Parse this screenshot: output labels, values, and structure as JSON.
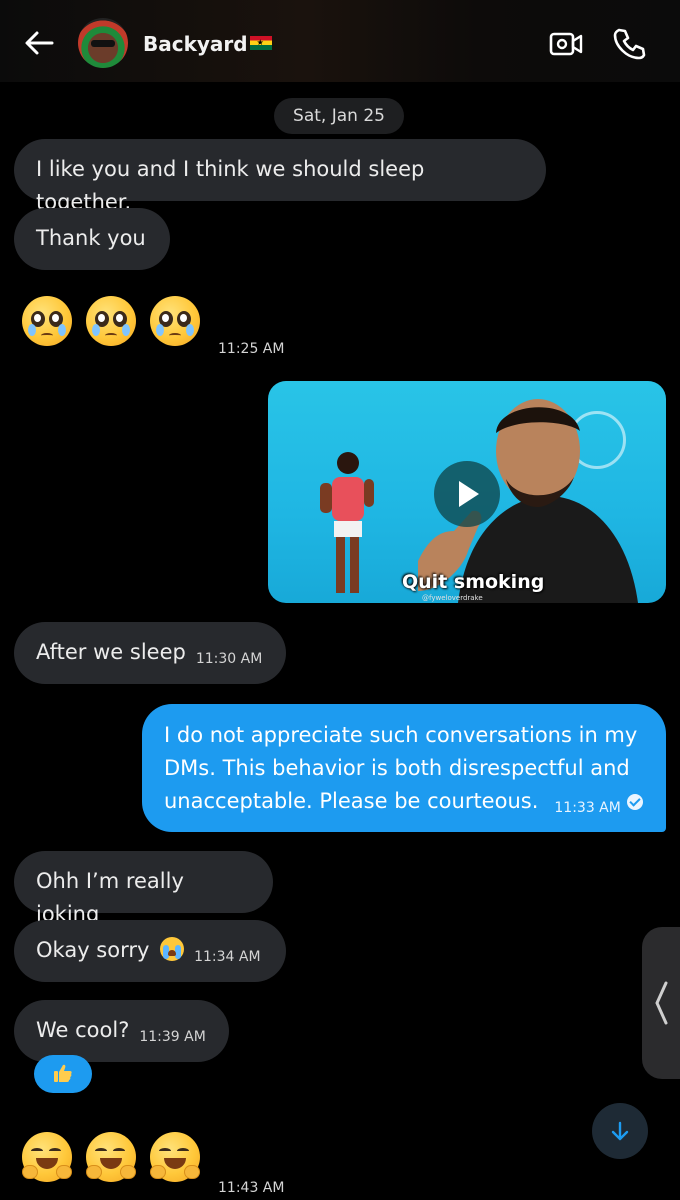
{
  "header": {
    "contact_name": "Backyard",
    "flag": "ghana-flag"
  },
  "conversation": {
    "date_label": "Sat, Jan 25",
    "messages": [
      {
        "from": "them",
        "text": "I like you and I think we should sleep together."
      },
      {
        "from": "them",
        "text": "Thank you"
      },
      {
        "from": "them",
        "emoji": "pleading-face x3",
        "time": "11:25 AM"
      },
      {
        "from": "me",
        "media": "video",
        "caption": "Quit smoking",
        "credit": "@fyweloverdrake"
      },
      {
        "from": "them",
        "text": "After we sleep",
        "time": "11:30 AM"
      },
      {
        "from": "me",
        "lines": [
          "I do not appreciate such conversations in my",
          "DMs. This behavior is both disrespectful and",
          "unacceptable. Please be courteous."
        ],
        "time": "11:33 AM",
        "status": "read"
      },
      {
        "from": "them",
        "text": "Ohh I’m really joking"
      },
      {
        "from": "them",
        "text": "Okay sorry",
        "emoji": "crying-face",
        "time": "11:34 AM"
      },
      {
        "from": "them",
        "text": "We cool?",
        "time": "11:39 AM",
        "reaction": "thumbs-up"
      },
      {
        "from": "them",
        "emoji": "hugging-face x3",
        "time": "11:43 AM"
      }
    ]
  },
  "colors": {
    "background": "#000000",
    "incoming_bubble": "#27292d",
    "outgoing_bubble": "#1d9bf0"
  }
}
